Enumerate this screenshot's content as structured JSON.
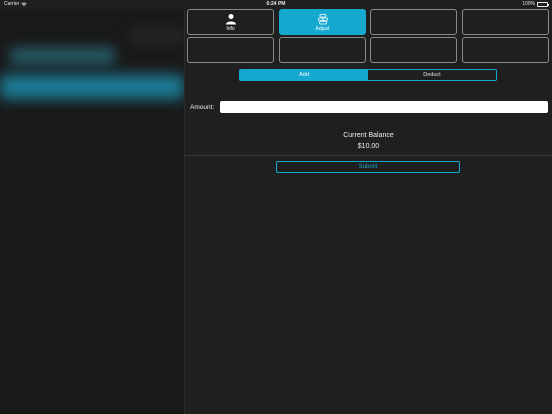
{
  "status_bar": {
    "carrier": "Carrier",
    "time": "6:24 PM",
    "battery": "100%"
  },
  "tiles": [
    {
      "label": "Info",
      "icon": "person-icon",
      "active": false
    },
    {
      "label": "Adjust",
      "icon": "coins-icon",
      "active": true
    },
    {
      "label": "",
      "icon": "",
      "active": false
    },
    {
      "label": "",
      "icon": "",
      "active": false
    },
    {
      "label": "",
      "icon": "",
      "active": false
    },
    {
      "label": "",
      "icon": "",
      "active": false
    },
    {
      "label": "",
      "icon": "",
      "active": false
    },
    {
      "label": "",
      "icon": "",
      "active": false
    }
  ],
  "segments": {
    "add": "Add",
    "deduct": "Deduct",
    "selected": "Add"
  },
  "amount": {
    "label": "Amount:",
    "value": "",
    "placeholder": ""
  },
  "balance": {
    "label": "Current Balance",
    "value": "$10.00"
  },
  "submit_label": "Submit",
  "colors": {
    "accent": "#15a9cf",
    "background": "#1f1f1f",
    "tile_border": "#8a8a8a"
  }
}
